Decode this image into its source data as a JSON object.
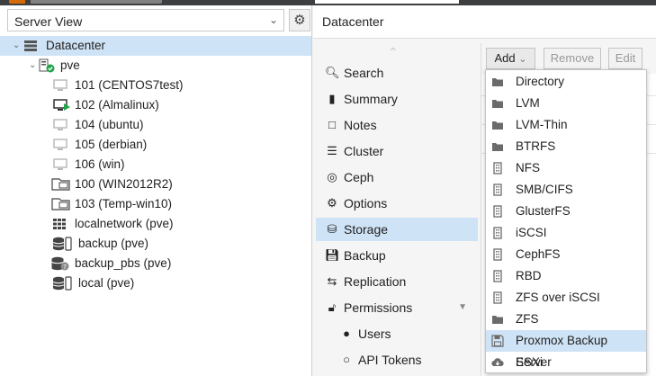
{
  "selector": {
    "value": "Server View"
  },
  "tree": [
    {
      "label": "Datacenter",
      "icon": "datacenter-icon"
    },
    {
      "label": "pve",
      "icon": "node-online-icon"
    },
    {
      "label": "101 (CENTOS7test)",
      "icon": "vm-stopped-icon"
    },
    {
      "label": "102 (Almalinux)",
      "icon": "vm-running-icon"
    },
    {
      "label": "104 (ubuntu)",
      "icon": "vm-stopped-icon"
    },
    {
      "label": "105 (derbian)",
      "icon": "vm-stopped-icon"
    },
    {
      "label": "106 (win)",
      "icon": "vm-stopped-icon"
    },
    {
      "label": "100 (WIN2012R2)",
      "icon": "template-icon"
    },
    {
      "label": "103 (Temp-win10)",
      "icon": "template-icon"
    },
    {
      "label": "localnetwork (pve)",
      "icon": "network-icon"
    },
    {
      "label": "backup (pve)",
      "icon": "storage-icon"
    },
    {
      "label": "backup_pbs (pve)",
      "icon": "storage-unknown-icon"
    },
    {
      "label": "local (pve)",
      "icon": "storage-icon"
    }
  ],
  "header": {
    "title": "Datacenter"
  },
  "nav": [
    {
      "label": "Search",
      "icon": "search-icon"
    },
    {
      "label": "Summary",
      "icon": "book-icon"
    },
    {
      "label": "Notes",
      "icon": "notes-icon"
    },
    {
      "label": "Cluster",
      "icon": "server-icon"
    },
    {
      "label": "Ceph",
      "icon": "ceph-icon"
    },
    {
      "label": "Options",
      "icon": "gear-icon"
    },
    {
      "label": "Storage",
      "icon": "database-icon"
    },
    {
      "label": "Backup",
      "icon": "floppy-icon"
    },
    {
      "label": "Replication",
      "icon": "retweet-icon"
    },
    {
      "label": "Permissions",
      "icon": "unlock-icon"
    },
    {
      "label": "Users",
      "icon": "user-icon"
    },
    {
      "label": "API Tokens",
      "icon": "user-outline-icon"
    }
  ],
  "toolbar": {
    "add": "Add",
    "remove": "Remove",
    "edit": "Edit"
  },
  "menu": [
    {
      "label": "Directory",
      "icon": "folder-icon"
    },
    {
      "label": "LVM",
      "icon": "folder-icon"
    },
    {
      "label": "LVM-Thin",
      "icon": "folder-icon"
    },
    {
      "label": "BTRFS",
      "icon": "folder-icon"
    },
    {
      "label": "NFS",
      "icon": "building-icon"
    },
    {
      "label": "SMB/CIFS",
      "icon": "building-icon"
    },
    {
      "label": "GlusterFS",
      "icon": "building-icon"
    },
    {
      "label": "iSCSI",
      "icon": "building-icon"
    },
    {
      "label": "CephFS",
      "icon": "building-icon"
    },
    {
      "label": "RBD",
      "icon": "building-icon"
    },
    {
      "label": "ZFS over iSCSI",
      "icon": "building-icon"
    },
    {
      "label": "ZFS",
      "icon": "folder-icon"
    },
    {
      "label": "Proxmox Backup Server",
      "icon": "floppy-icon"
    },
    {
      "label": "ESXi",
      "icon": "cloud-download-icon"
    }
  ]
}
